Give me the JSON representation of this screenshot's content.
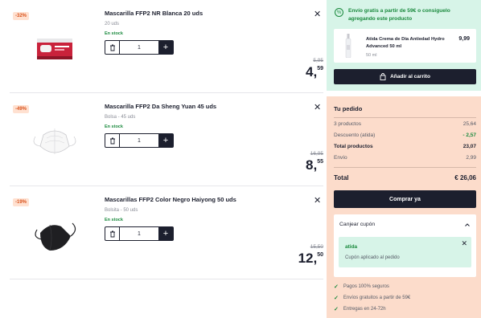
{
  "cart": {
    "items": [
      {
        "discount": "-32%",
        "name": "Mascarilla FFP2 NR Blanca 20 uds",
        "variant": "20 uds",
        "stock": "En stock",
        "quantity": "1",
        "old_price": "5,95",
        "price_int": "4,",
        "price_dec": "59",
        "icon": "ffp2-box-image"
      },
      {
        "discount": "-49%",
        "name": "Mascarilla FFP2 Da Sheng Yuan 45 uds",
        "variant": "Bolsa - 45 uds",
        "stock": "En stock",
        "quantity": "1",
        "old_price": "16,95",
        "price_int": "8,",
        "price_dec": "55",
        "icon": "white-mask-image"
      },
      {
        "discount": "-19%",
        "name": "Mascarillas FFP2 Color Negro Haiyong 50 uds",
        "variant": "Bolsita - 50 uds",
        "stock": "En stock",
        "quantity": "1",
        "old_price": "15,50",
        "price_int": "12,",
        "price_dec": "50",
        "icon": "black-mask-image"
      }
    ]
  },
  "promo": {
    "message": "Envío gratis a partir de 59€ o consiguelo agregando este producto",
    "product_name": "Atida Crema de Día Antiedad Hydro Advanced 50 ml",
    "product_size": "50 ml",
    "product_price": "9,99",
    "add_button": "Añadir al carrito"
  },
  "order": {
    "title": "Tu pedido",
    "rows": [
      {
        "label": "3 productos",
        "value": "25,64"
      },
      {
        "label": "Descuento (atida)",
        "value": "- 2,57"
      },
      {
        "label": "Total productos",
        "value": "23,07"
      },
      {
        "label": "Envío",
        "value": "2,99"
      }
    ],
    "total_label": "Total",
    "total_value": "€ 26,06",
    "buy_button": "Comprar ya",
    "coupon": {
      "header": "Canjear cupón",
      "code": "atida",
      "message": "Cupón aplicado al pedido"
    },
    "trust": [
      "Pagos 100% seguros",
      "Envíos gratuitos a partir de 59€",
      "Entregas en 24-72h"
    ]
  },
  "colors": {
    "dark": "#1c1f2e",
    "green": "#1b8a3e",
    "mint": "#d7f4e8",
    "peach": "#fcdccb"
  }
}
